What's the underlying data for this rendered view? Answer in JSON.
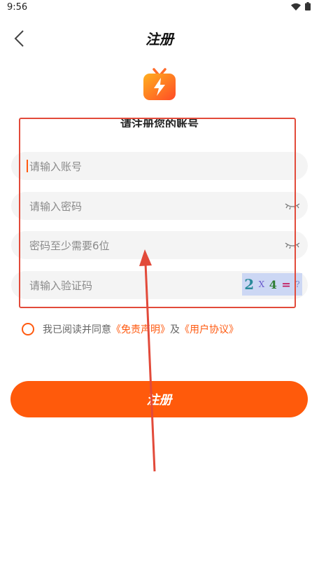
{
  "status_bar": {
    "time": "9:56"
  },
  "header": {
    "title": "注册"
  },
  "form": {
    "subtitle": "请注册您的账号",
    "account_placeholder": "请输入账号",
    "password_placeholder": "请输入密码",
    "confirm_placeholder": "密码至少需要6位",
    "captcha_placeholder": "请输入验证码",
    "captcha": {
      "a": "2",
      "op": "X",
      "b": "4",
      "eq": "=",
      "q": "?"
    }
  },
  "agreement": {
    "prefix": "我已阅读并同意",
    "disclaimer_link": "《免责声明》",
    "and": "及",
    "user_link": "《用户协议》"
  },
  "submit_label": "注册",
  "colors": {
    "accent": "#ff5a0b",
    "annotation": "#e24a3a"
  }
}
